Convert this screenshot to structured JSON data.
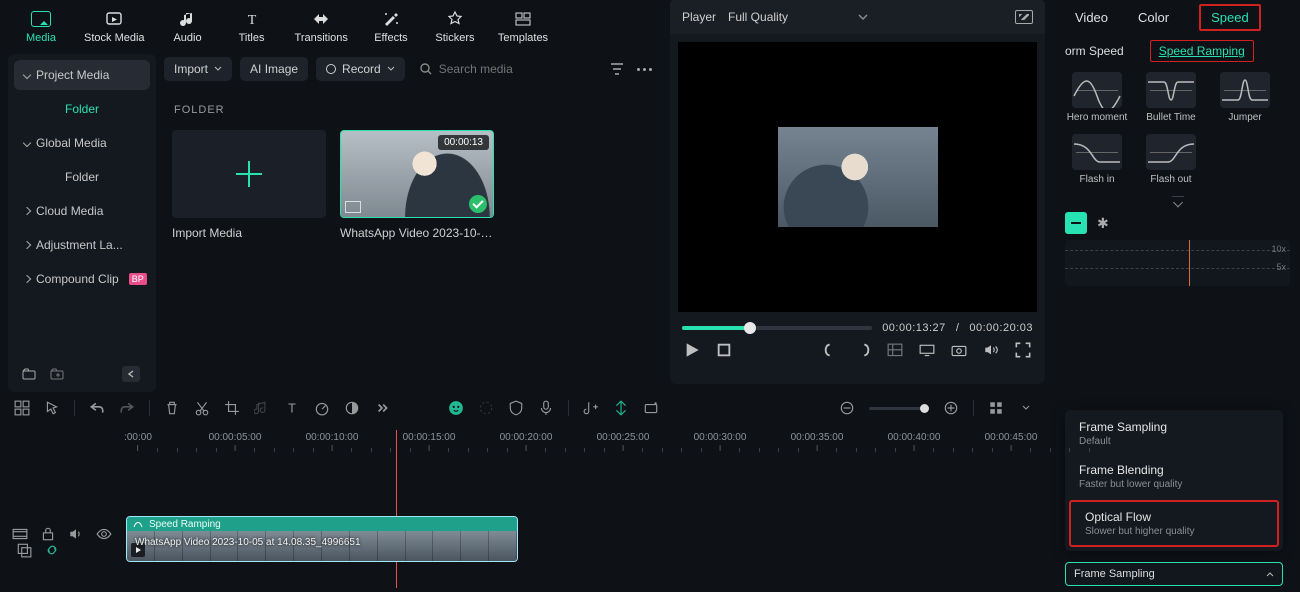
{
  "top_tabs": {
    "media": "Media",
    "stock": "Stock Media",
    "audio": "Audio",
    "titles": "Titles",
    "transitions": "Transitions",
    "effects": "Effects",
    "stickers": "Stickers",
    "templates": "Templates"
  },
  "player_header": {
    "label": "Player",
    "quality": "Full Quality"
  },
  "inspector_tabs": {
    "video": "Video",
    "color": "Color",
    "speed": "Speed"
  },
  "sidebar": {
    "project_media": "Project Media",
    "folder": "Folder",
    "global_media": "Global Media",
    "folder2": "Folder",
    "cloud_media": "Cloud Media",
    "adjustment": "Adjustment La...",
    "compound": "Compound Clip",
    "badge": "BP"
  },
  "media_bar": {
    "import": "Import",
    "ai_image": "AI Image",
    "record": "Record",
    "search_placeholder": "Search media"
  },
  "folder_label": "FOLDER",
  "tiles": {
    "import_caption": "Import Media",
    "video_caption": "WhatsApp Video 2023-10-05...",
    "video_duration": "00:00:13"
  },
  "player": {
    "cur": "00:00:13:27",
    "sep": "/",
    "dur": "00:00:20:03"
  },
  "speed_panel": {
    "uniform": "orm Speed",
    "ramping": "Speed Ramping",
    "presets": {
      "hero": "Hero moment",
      "bullet": "Bullet Time",
      "jumper": "Jumper",
      "flashin": "Flash in",
      "flashout": "Flash out"
    },
    "ramp_labels": {
      "a": "10x",
      "b": "5x"
    }
  },
  "interpolation": {
    "frame_sampling": {
      "title": "Frame Sampling",
      "sub": "Default"
    },
    "frame_blending": {
      "title": "Frame Blending",
      "sub": "Faster but lower quality"
    },
    "optical_flow": {
      "title": "Optical Flow",
      "sub": "Slower but higher quality"
    },
    "selected": "Frame Sampling"
  },
  "ruler": [
    ":00:00",
    "00:00:05:00",
    "00:00:10:00",
    "00:00:15:00",
    "00:00:20:00",
    "00:00:25:00",
    "00:00:30:00",
    "00:00:35:00",
    "00:00:40:00",
    "00:00:45:00"
  ],
  "clip": {
    "ribbon": "Speed Ramping",
    "caption": "WhatsApp Video 2023-10-05 at 14.08.35_4996651"
  }
}
